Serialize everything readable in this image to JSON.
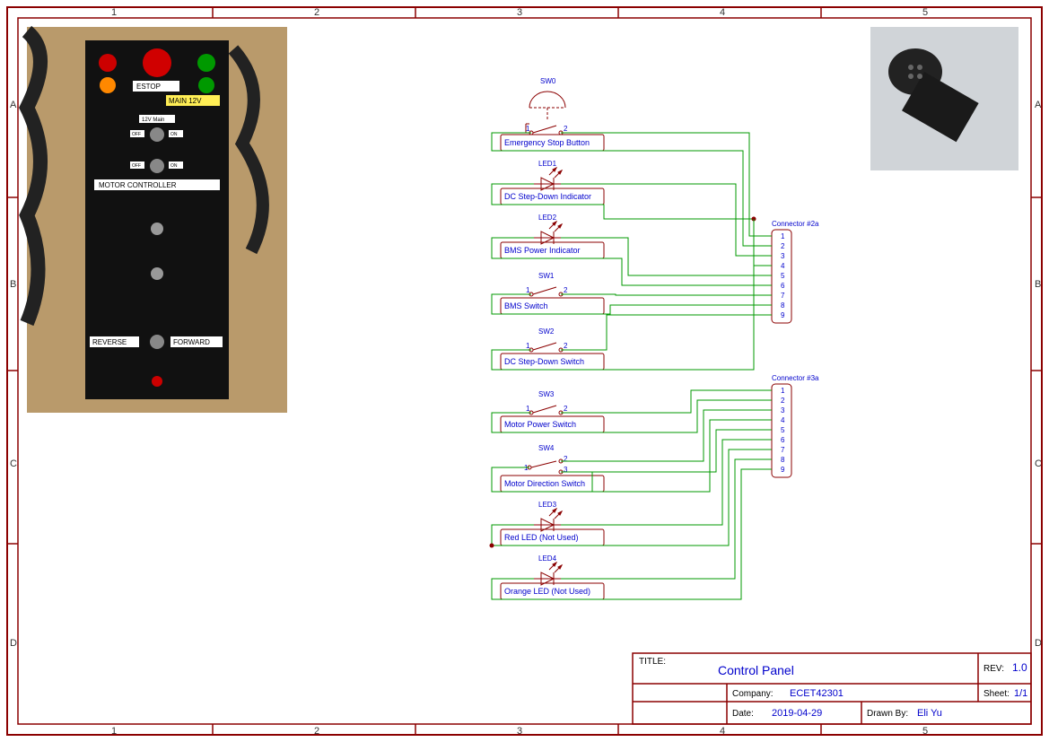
{
  "sheet": {
    "columns": [
      "1",
      "2",
      "3",
      "4",
      "5"
    ],
    "rows": [
      "A",
      "B",
      "C",
      "D"
    ]
  },
  "titleblock": {
    "titleLabel": "TITLE:",
    "title": "Control Panel",
    "revLabel": "REV:",
    "rev": "1.0",
    "companyLabel": "Company:",
    "company": "ECET42301",
    "sheetLabel": "Sheet:",
    "sheet": "1/1",
    "dateLabel": "Date:",
    "date": "2019-04-29",
    "drawnByLabel": "Drawn By:",
    "drawnBy": "Eli Yu"
  },
  "components": {
    "sw0": {
      "ref": "SW0",
      "name": "Emergency Stop Button",
      "p1": "1",
      "p2": "2"
    },
    "led1": {
      "ref": "LED1",
      "name": "DC Step-Down Indicator"
    },
    "led2": {
      "ref": "LED2",
      "name": "BMS Power Indicator"
    },
    "sw1": {
      "ref": "SW1",
      "name": "BMS Switch",
      "p1": "1",
      "p2": "2"
    },
    "sw2": {
      "ref": "SW2",
      "name": "DC Step-Down Switch",
      "p1": "1",
      "p2": "2"
    },
    "sw3": {
      "ref": "SW3",
      "name": "Motor Power Switch",
      "p1": "1",
      "p2": "2"
    },
    "sw4": {
      "ref": "SW4",
      "name": "Motor Direction Switch",
      "p1": "1",
      "p2": "2",
      "p3": "3"
    },
    "led3": {
      "ref": "LED3",
      "name": "Red LED (Not Used)"
    },
    "led4": {
      "ref": "LED4",
      "name": "Orange LED (Not Used)"
    }
  },
  "connectors": {
    "c2a": {
      "name": "Connector #2a",
      "pins": [
        "1",
        "2",
        "3",
        "4",
        "5",
        "6",
        "7",
        "8",
        "9"
      ]
    },
    "c3a": {
      "name": "Connector #3a",
      "pins": [
        "1",
        "2",
        "3",
        "4",
        "5",
        "6",
        "7",
        "8",
        "9"
      ]
    }
  },
  "photo": {
    "estop": "ESTOP",
    "main12v": "MAIN 12V",
    "mc": "MOTOR CONTROLLER",
    "rev": "REVERSE",
    "fwd": "FORWARD",
    "main": "12V Main",
    "off": "OFF",
    "on": "ON"
  }
}
